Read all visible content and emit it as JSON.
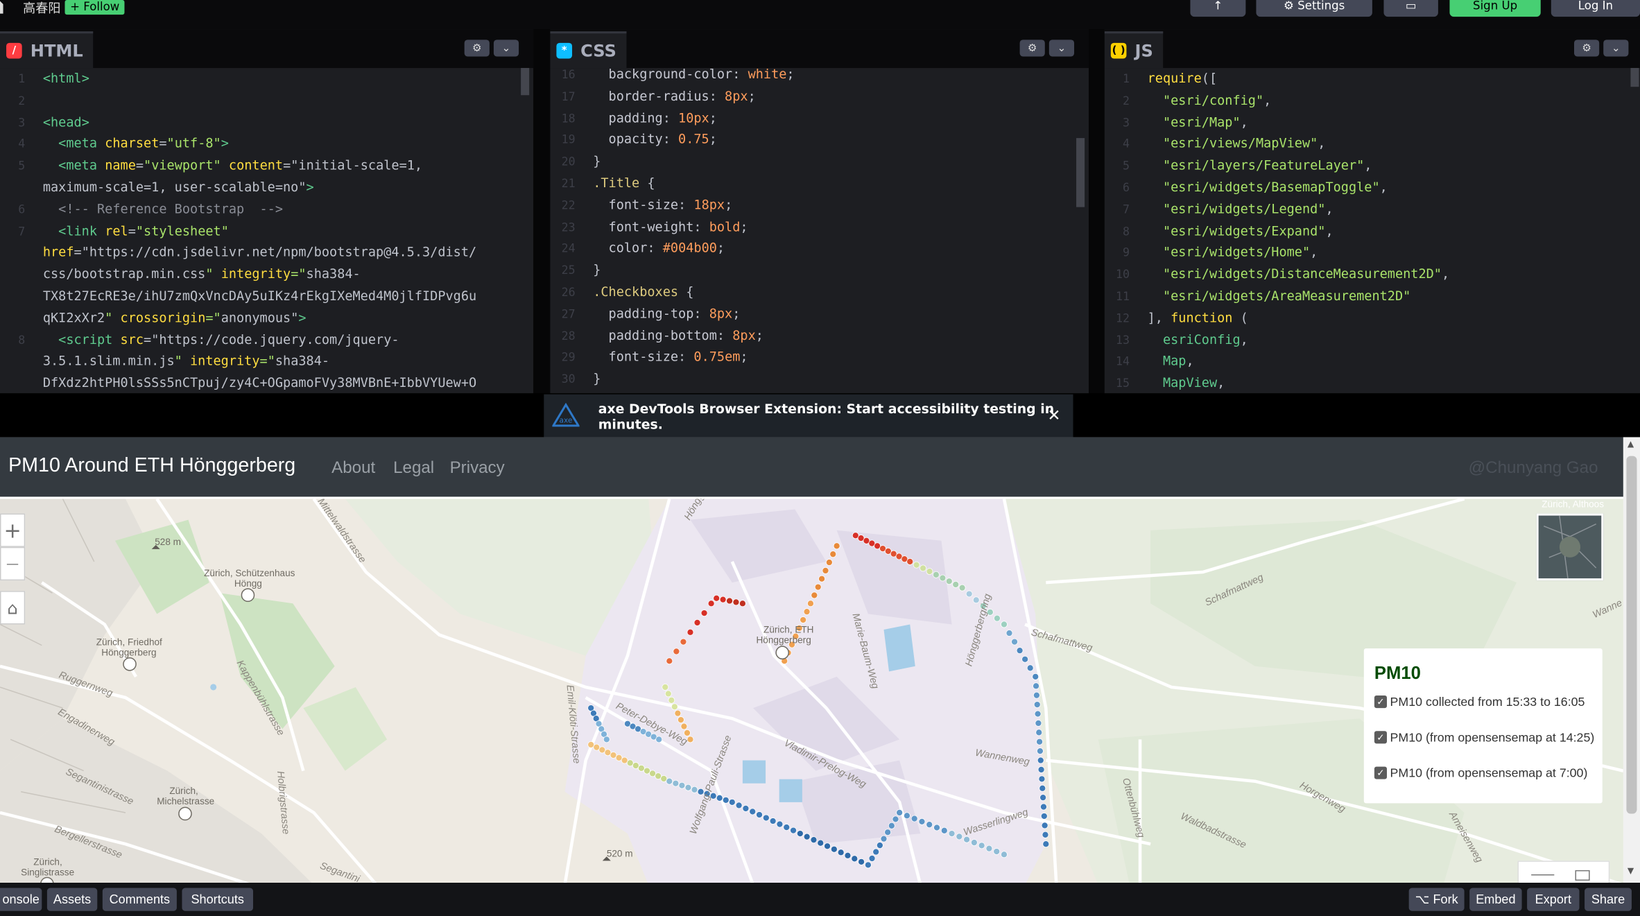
{
  "topbar": {
    "author": "高春阳",
    "follow": "+ Follow",
    "buttons": [
      "↑",
      "⚙ Settings",
      "▭",
      "Sign Up",
      "Log In"
    ]
  },
  "editors": {
    "html": {
      "label": "HTML",
      "icon": "/",
      "color": "#ff3c41"
    },
    "css": {
      "label": "CSS",
      "icon": "*",
      "color": "#0ebeff"
    },
    "js": {
      "label": "JS",
      "icon": "( )",
      "color": "#fcd000"
    },
    "gear": "⚙",
    "chevron": "⌄"
  },
  "html_code": [
    {
      "n": "1",
      "t": "<html>"
    },
    {
      "n": "2",
      "t": ""
    },
    {
      "n": "3",
      "t": "<head>"
    },
    {
      "n": "4",
      "t": "  <meta charset=\"utf-8\">"
    },
    {
      "n": "5",
      "t": "  <meta name=\"viewport\" content=\"initial-scale=1,"
    },
    {
      "n": "",
      "t": "maximum-scale=1, user-scalable=no\">"
    },
    {
      "n": "6",
      "t": "  <!-- Reference Bootstrap  -->"
    },
    {
      "n": "7",
      "t": "  <link rel=\"stylesheet\""
    },
    {
      "n": "",
      "t": "href=\"https://cdn.jsdelivr.net/npm/bootstrap@4.5.3/dist/"
    },
    {
      "n": "",
      "t": "css/bootstrap.min.css\" integrity=\"sha384-"
    },
    {
      "n": "",
      "t": "TX8t27EcRE3e/ihU7zmQxVncDAy5uIKz4rEkgIXeMed4M0jlfIDPvg6u"
    },
    {
      "n": "",
      "t": "qKI2xXr2\" crossorigin=\"anonymous\">"
    },
    {
      "n": "8",
      "t": "  <script src=\"https://code.jquery.com/jquery-"
    },
    {
      "n": "",
      "t": "3.5.1.slim.min.js\" integrity=\"sha384-"
    },
    {
      "n": "",
      "t": "DfXdz2htPH0lsSSs5nCTpuj/zy4C+OGpamoFVy38MVBnE+IbbVYUew+O"
    }
  ],
  "css_code": [
    {
      "n": "16",
      "t": "  background-color: white;"
    },
    {
      "n": "17",
      "t": "  border-radius: 8px;"
    },
    {
      "n": "18",
      "t": "  padding: 10px;"
    },
    {
      "n": "19",
      "t": "  opacity: 0.75;"
    },
    {
      "n": "20",
      "t": "}"
    },
    {
      "n": "21",
      "t": ".Title {"
    },
    {
      "n": "22",
      "t": "  font-size: 18px;"
    },
    {
      "n": "23",
      "t": "  font-weight: bold;"
    },
    {
      "n": "24",
      "t": "  color: #004b00;"
    },
    {
      "n": "25",
      "t": "}"
    },
    {
      "n": "26",
      "t": ".Checkboxes {"
    },
    {
      "n": "27",
      "t": "  padding-top: 8px;"
    },
    {
      "n": "28",
      "t": "  padding-bottom: 8px;"
    },
    {
      "n": "29",
      "t": "  font-size: 0.75em;"
    },
    {
      "n": "30",
      "t": "}"
    }
  ],
  "js_code": [
    {
      "n": "1",
      "t": "require(["
    },
    {
      "n": "2",
      "t": "  \"esri/config\","
    },
    {
      "n": "3",
      "t": "  \"esri/Map\","
    },
    {
      "n": "4",
      "t": "  \"esri/views/MapView\","
    },
    {
      "n": "5",
      "t": "  \"esri/layers/FeatureLayer\","
    },
    {
      "n": "6",
      "t": "  \"esri/widgets/BasemapToggle\","
    },
    {
      "n": "7",
      "t": "  \"esri/widgets/Legend\","
    },
    {
      "n": "8",
      "t": "  \"esri/widgets/Expand\","
    },
    {
      "n": "9",
      "t": "  \"esri/widgets/Home\","
    },
    {
      "n": "10",
      "t": "  \"esri/widgets/DistanceMeasurement2D\","
    },
    {
      "n": "11",
      "t": "  \"esri/widgets/AreaMeasurement2D\""
    },
    {
      "n": "12",
      "t": "], function ("
    },
    {
      "n": "13",
      "t": "  esriConfig,"
    },
    {
      "n": "14",
      "t": "  Map,"
    },
    {
      "n": "15",
      "t": "  MapView,"
    }
  ],
  "banner": {
    "message": "axe DevTools Browser Extension: Start accessibility testing in minutes.",
    "close": "✕"
  },
  "preview": {
    "brand": "PM10 Around ETH Hönggerberg",
    "nav": [
      "About",
      "Legal",
      "Privacy"
    ],
    "credit": "@Chunyang Gao",
    "zoom_in": "+",
    "zoom_out": "—",
    "home": "⌂",
    "legend": {
      "title": "PM10",
      "items": [
        "PM10 collected from 15:33 to 16:05",
        "PM10 (from opensensemap at 14:25)",
        "PM10 (from opensensemap at 7:00)"
      ],
      "checkmark": "✓"
    },
    "map_labels": [
      "528 m",
      "Zürich, Schützenhaus",
      "Höngg",
      "Zürich, Friedhof",
      "Hönggerberg",
      "Zürich, ETH",
      "Hönggerberg",
      "Zürich,",
      "Michelstrasse",
      "Zürich,",
      "Singlistrasse",
      "520 m",
      "Zürich, Althoos"
    ],
    "street_labels": [
      "Ruggernweg",
      "Engadinerweg",
      "Segantinistrasse",
      "Bergellerstrasse",
      "Kappenbühlstrasse",
      "Holbrigstrasse",
      "Emil-Klöti-Strasse",
      "Peter-Debye-Weg",
      "Wolfgang-Pauli-Strasse",
      "Vladimir-Prelog-Weg",
      "Marie-Baum-Weg",
      "Hönggerbergring",
      "Schafmattweg",
      "Wannenweg",
      "Wasserlingweg",
      "Ottenbühlweg",
      "Waldbadstrasse",
      "Horgenweg",
      "Ameisenweg",
      "Schafmattweg",
      "Segantini",
      "Höngg",
      "Mittelwaldstrasse",
      "Wanne"
    ]
  },
  "bottombar": {
    "left": [
      "onsole",
      "Assets",
      "Comments",
      "Shortcuts"
    ],
    "right": [
      "⌥ Fork",
      "Embed",
      "Export",
      "Share"
    ]
  }
}
